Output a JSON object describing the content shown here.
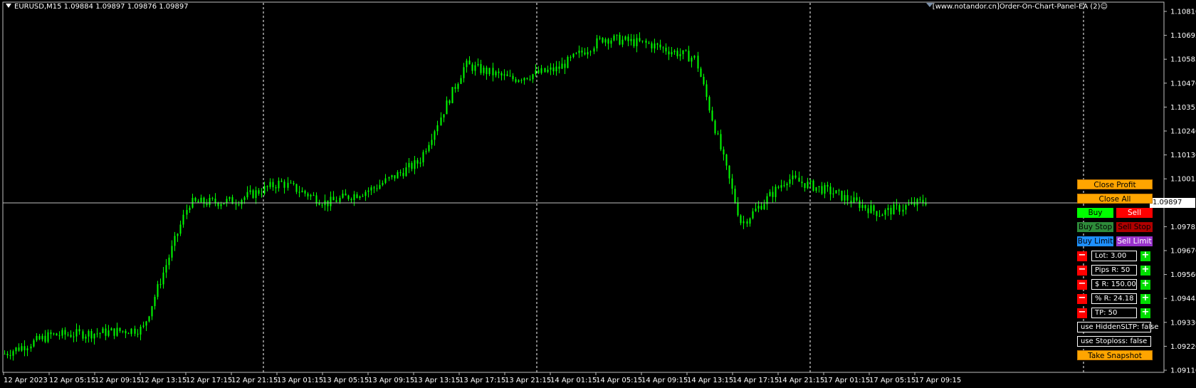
{
  "header": {
    "symbol_info": "EURUSD,M15  1.09884 1.09897 1.09876 1.09897",
    "ea_label": "[www.notandor.cn]Order-On-Chart-Panel-EA (2)☺"
  },
  "price_axis": {
    "ticks": [
      "1.10810",
      "1.10695",
      "1.10585",
      "1.10470",
      "1.10355",
      "1.10240",
      "1.10130",
      "1.10015",
      "1.09897",
      "1.09785",
      "1.09670",
      "1.09560",
      "1.09445",
      "1.09330",
      "1.09220",
      "1.09110"
    ],
    "current_price": "1.09897",
    "range": [
      1.0908,
      1.1087
    ]
  },
  "time_axis": {
    "ticks": [
      "12 Apr 2023",
      "12 Apr 05:15",
      "12 Apr 09:15",
      "12 Apr 13:15",
      "12 Apr 17:15",
      "12 Apr 21:15",
      "13 Apr 01:15",
      "13 Apr 05:15",
      "13 Apr 09:15",
      "13 Apr 13:15",
      "13 Apr 17:15",
      "13 Apr 21:15",
      "14 Apr 01:15",
      "14 Apr 05:15",
      "14 Apr 09:15",
      "14 Apr 13:15",
      "14 Apr 17:15",
      "14 Apr 21:15",
      "17 Apr 01:15",
      "17 Apr 05:15",
      "17 Apr 09:15"
    ]
  },
  "colors": {
    "background": "#000000",
    "candle": "#00ff00",
    "grid": "#ffffff",
    "bid_line": "#c0c0c0"
  },
  "chart_data": {
    "type": "line",
    "title": "EURUSD,M15",
    "x": [
      "12 Apr 2023",
      "12 Apr 05:15",
      "12 Apr 09:15",
      "12 Apr 13:15",
      "12 Apr 17:15",
      "12 Apr 21:15",
      "13 Apr 01:15",
      "13 Apr 05:15",
      "13 Apr 09:15",
      "13 Apr 13:15",
      "13 Apr 17:15",
      "13 Apr 21:15",
      "14 Apr 01:15",
      "14 Apr 05:15",
      "14 Apr 09:15",
      "14 Apr 13:15",
      "14 Apr 17:15",
      "14 Apr 21:15",
      "17 Apr 01:15",
      "17 Apr 05:15",
      "17 Apr 09:15"
    ],
    "series": [
      {
        "values": [
          1.0917,
          1.0926,
          1.0927,
          1.0929,
          1.099,
          1.0991,
          1.1,
          1.099,
          1.0997,
          1.101,
          1.1057,
          1.105,
          1.1055,
          1.107,
          1.1067,
          1.106,
          1.098,
          1.1002,
          1.0995,
          1.0985,
          1.0991
        ]
      }
    ],
    "ylim": [
      1.0908,
      1.1087
    ],
    "grid": false
  },
  "panel": {
    "close_profit": "Close Profit",
    "close_all": "Close All",
    "buy": "Buy",
    "sell": "Sell",
    "buy_stop": "Buy Stop",
    "sell_stop": "Sell Stop",
    "buy_limit": "Buy Limit",
    "sell_limit": "Sell Limit",
    "lot": "Lot: 3.00",
    "pips_r": "Pips R: 50",
    "dollar_r": "$ R: 150.00",
    "pct_r": "% R: 24.18",
    "tp": "TP: 50",
    "hidden_sltp": "use HiddenSLTP: false",
    "stoploss": "use Stoploss: false",
    "snapshot": "Take Snapshot",
    "minus": "−",
    "plus": "+"
  }
}
